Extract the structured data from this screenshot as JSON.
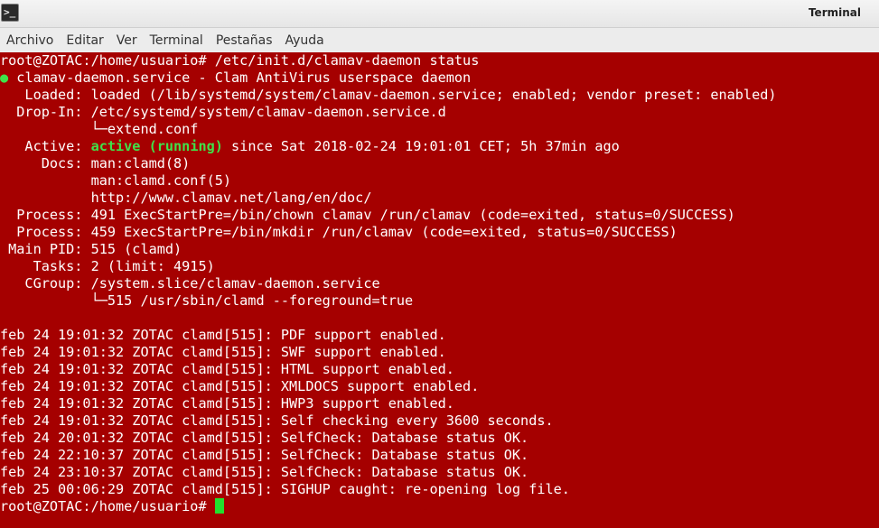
{
  "window": {
    "title": "Terminal",
    "icon": "terminal-icon"
  },
  "menu": {
    "items": [
      "Archivo",
      "Editar",
      "Ver",
      "Terminal",
      "Pestañas",
      "Ayuda"
    ]
  },
  "colors": {
    "background": "#a50000",
    "text": "#ffffff",
    "status_active": "#3fe34a",
    "cursor": "#22e02e"
  },
  "terminal": {
    "prompt1": "root@ZOTAC:/home/usuario# /etc/init.d/clamav-daemon status",
    "status_dot": "●",
    "service_line": " clamav-daemon.service - Clam AntiVirus userspace daemon",
    "loaded": "   Loaded: loaded (/lib/systemd/system/clamav-daemon.service; enabled; vendor preset: enabled)",
    "dropin": "  Drop-In: /etc/systemd/system/clamav-daemon.service.d",
    "dropin_file": "           └─extend.conf",
    "active_label": "   Active: ",
    "active_state": "active (running)",
    "active_since": " since Sat 2018-02-24 19:01:01 CET; 5h 37min ago",
    "docs1": "     Docs: man:clamd(8)",
    "docs2": "           man:clamd.conf(5)",
    "docs3": "           http://www.clamav.net/lang/en/doc/",
    "process1": "  Process: 491 ExecStartPre=/bin/chown clamav /run/clamav (code=exited, status=0/SUCCESS)",
    "process2": "  Process: 459 ExecStartPre=/bin/mkdir /run/clamav (code=exited, status=0/SUCCESS)",
    "mainpid": " Main PID: 515 (clamd)",
    "tasks": "    Tasks: 2 (limit: 4915)",
    "cgroup": "   CGroup: /system.slice/clamav-daemon.service",
    "cgroup_child": "           └─515 /usr/sbin/clamd --foreground=true",
    "logs": [
      "feb 24 19:01:32 ZOTAC clamd[515]: PDF support enabled.",
      "feb 24 19:01:32 ZOTAC clamd[515]: SWF support enabled.",
      "feb 24 19:01:32 ZOTAC clamd[515]: HTML support enabled.",
      "feb 24 19:01:32 ZOTAC clamd[515]: XMLDOCS support enabled.",
      "feb 24 19:01:32 ZOTAC clamd[515]: HWP3 support enabled.",
      "feb 24 19:01:32 ZOTAC clamd[515]: Self checking every 3600 seconds.",
      "feb 24 20:01:32 ZOTAC clamd[515]: SelfCheck: Database status OK.",
      "feb 24 22:10:37 ZOTAC clamd[515]: SelfCheck: Database status OK.",
      "feb 24 23:10:37 ZOTAC clamd[515]: SelfCheck: Database status OK.",
      "feb 25 00:06:29 ZOTAC clamd[515]: SIGHUP caught: re-opening log file."
    ],
    "prompt2": "root@ZOTAC:/home/usuario# "
  }
}
